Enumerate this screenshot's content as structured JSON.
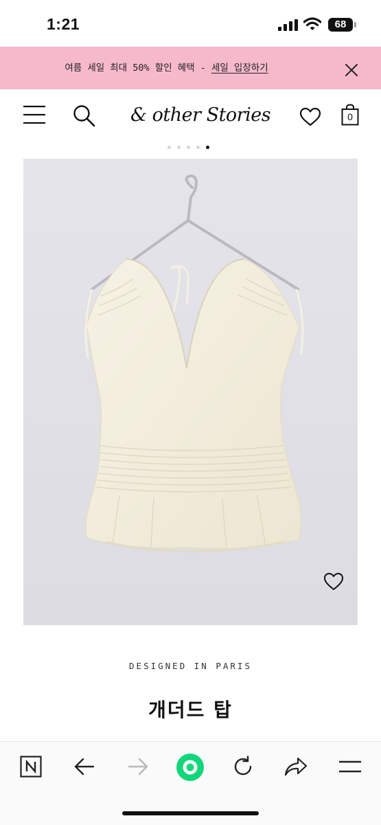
{
  "status_bar": {
    "time": "1:21",
    "battery": "68"
  },
  "promo": {
    "text": "여름 세일 최대 50% 할인 혜택 - ",
    "link": "세일 입장하기"
  },
  "header": {
    "logo": "& other Stories",
    "bag_count": "0"
  },
  "carousel": {
    "total": 5,
    "active_index": 4
  },
  "product": {
    "designed_label": "DESIGNED IN PARIS",
    "title": "개더드 탑"
  },
  "colors": {
    "promo_bg": "#f6b9cc",
    "image_bg": "#e1e1e7",
    "garment": "#f3efdf",
    "nav_green": "#12d67a"
  },
  "icons": {
    "header": [
      "menu-icon",
      "search-icon",
      "heart-icon",
      "bag-icon"
    ],
    "toolbar": [
      "naver-icon",
      "back-arrow-icon",
      "forward-arrow-icon",
      "green-dot-icon",
      "reload-icon",
      "share-icon",
      "menu-icon"
    ]
  }
}
